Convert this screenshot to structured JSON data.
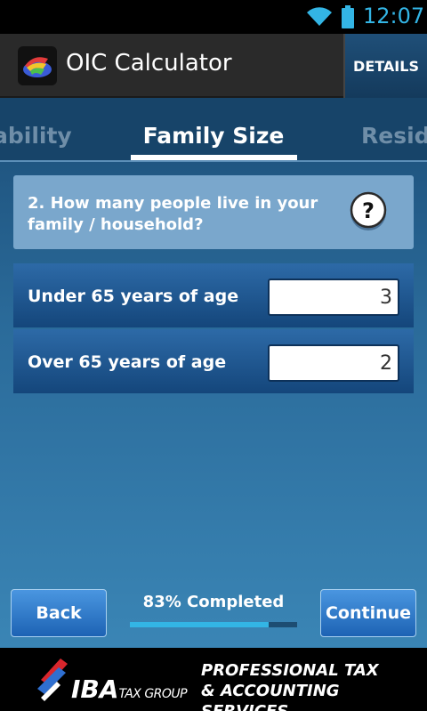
{
  "status_bar": {
    "time": "12:07"
  },
  "app_bar": {
    "title": "OIC Calculator",
    "details_label": "DETAILS"
  },
  "tabs": [
    {
      "label": "ability",
      "active": false
    },
    {
      "label": "Family Size",
      "active": true
    },
    {
      "label": "Reside",
      "active": false
    }
  ],
  "question": {
    "text": "2. How many people live in your family / household?"
  },
  "fields": [
    {
      "label": "Under 65 years of age",
      "value": "3"
    },
    {
      "label": "Over 65 years of age",
      "value": "2"
    }
  ],
  "footer_nav": {
    "back_label": "Back",
    "continue_label": "Continue",
    "progress_text": "83% Completed",
    "progress_fraction": 0.83
  },
  "footer": {
    "brand_main": "IBA",
    "brand_sub": "TAX GROUP",
    "tagline_line1": "PROFESSIONAL TAX",
    "tagline_line2": "& ACCOUNTING SERVICES"
  },
  "colors": {
    "accent": "#33b5e5",
    "button_blue": "#2f7bcc",
    "brand_red": "#d8262c"
  }
}
